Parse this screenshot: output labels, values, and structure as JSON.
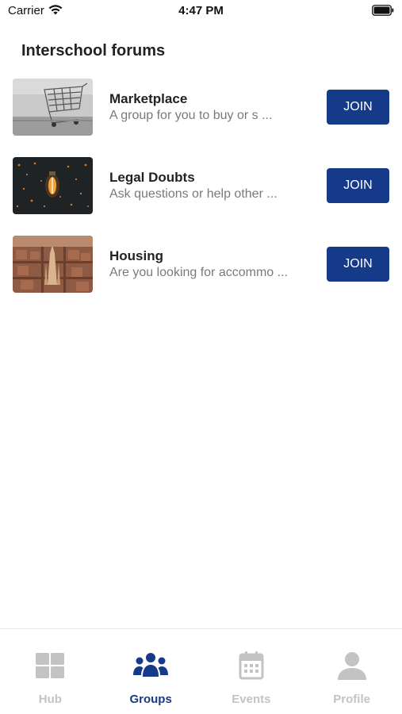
{
  "status_bar": {
    "carrier": "Carrier",
    "time": "4:47 PM",
    "wifi_icon": "wifi-icon",
    "battery_icon": "battery-icon"
  },
  "page": {
    "title": "Interschool forums"
  },
  "forums": [
    {
      "name": "Marketplace",
      "description": "A group for you to buy or s ...",
      "join_label": "JOIN",
      "thumbnail": "shopping-cart-photo"
    },
    {
      "name": "Legal Doubts",
      "description": "Ask questions or help other ...",
      "join_label": "JOIN",
      "thumbnail": "light-bulb-photo"
    },
    {
      "name": "Housing",
      "description": "Are you looking for accommo ...",
      "join_label": "JOIN",
      "thumbnail": "city-aerial-photo"
    }
  ],
  "tab_bar": {
    "active": "Groups",
    "tabs": [
      {
        "label": "Hub",
        "icon": "grid-icon"
      },
      {
        "label": "Groups",
        "icon": "people-icon"
      },
      {
        "label": "Events",
        "icon": "calendar-icon"
      },
      {
        "label": "Profile",
        "icon": "user-icon"
      }
    ]
  },
  "colors": {
    "accent": "#153a8a",
    "inactive_tab": "#c3c3c3",
    "description_text": "#7a7a7a"
  }
}
